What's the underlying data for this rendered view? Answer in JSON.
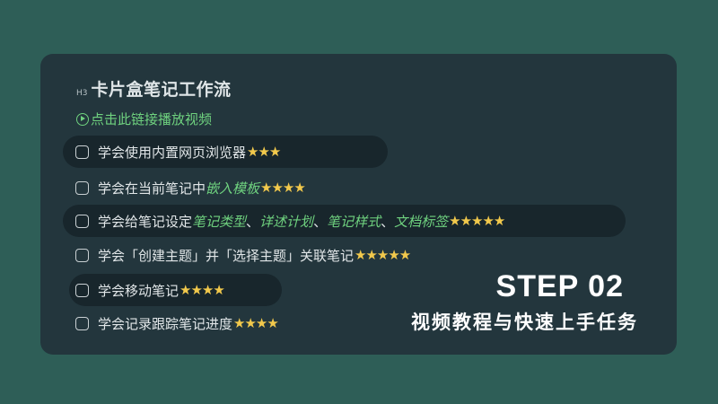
{
  "card": {
    "heading_tag": "H3",
    "title": "卡片盒笔记工作流",
    "video_link": "点击此链接播放视频"
  },
  "tasks": [
    {
      "parts": [
        "学会使用内置网页浏览器"
      ],
      "stars": "★★★",
      "highlighted": true
    },
    {
      "parts": [
        "学会在当前笔记中",
        "嵌入模板"
      ],
      "stars": "★★★★",
      "highlighted": false
    },
    {
      "parts": [
        "学会给笔记设定",
        "笔记类型",
        "、",
        "详述计划",
        "、",
        "笔记样式",
        "、",
        "文档标签"
      ],
      "stars": "★★★★★",
      "highlighted": true
    },
    {
      "parts": [
        "学会「创建主题」并「选择主题」关联笔记"
      ],
      "stars": "★★★★★",
      "highlighted": false
    },
    {
      "parts": [
        "学会移动笔记"
      ],
      "stars": "★★★★",
      "highlighted": true
    },
    {
      "parts": [
        "学会记录跟踪笔记进度"
      ],
      "stars": "★★★★",
      "highlighted": false
    }
  ],
  "overlay": {
    "step": "STEP 02",
    "subtitle": "视频教程与快速上手任务"
  },
  "colors": {
    "background": "#2e5e57",
    "card": "#23363d",
    "highlight": "#18262c",
    "accent_green": "#6fd27f",
    "star": "#f2c94c"
  }
}
